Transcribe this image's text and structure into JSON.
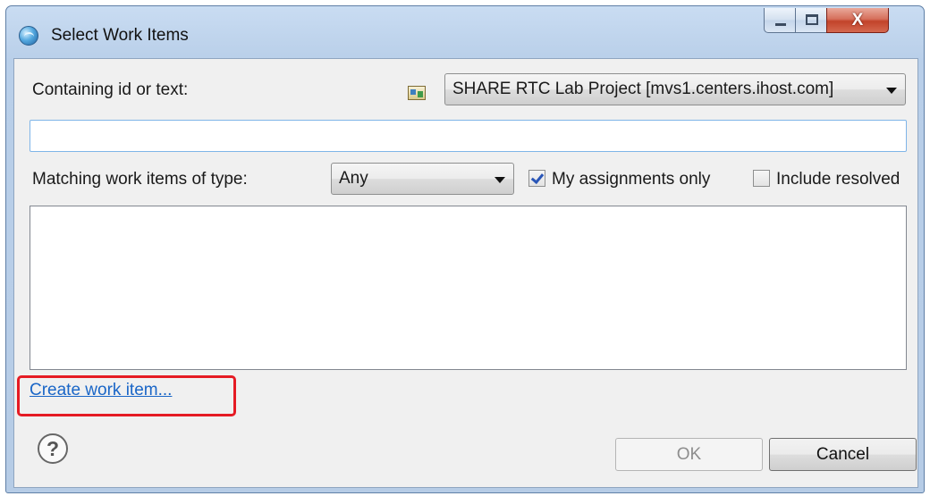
{
  "window": {
    "title": "Select Work Items"
  },
  "titlebar_buttons": {
    "close_glyph": "X"
  },
  "search": {
    "label": "Containing id or text:",
    "value": "",
    "placeholder": ""
  },
  "project": {
    "icon": "project-area-icon",
    "selected": "SHARE RTC Lab Project [mvs1.centers.ihost.com]"
  },
  "filter": {
    "type_label": "Matching work items of type:",
    "type_selected": "Any",
    "my_assignments_label": "My assignments only",
    "my_assignments_checked": true,
    "include_resolved_label": "Include resolved",
    "include_resolved_checked": false
  },
  "results": {
    "items": []
  },
  "create_link": "Create work item...",
  "help": {
    "glyph": "?"
  },
  "buttons": {
    "ok": "OK",
    "ok_enabled": false,
    "cancel": "Cancel"
  },
  "colors": {
    "link": "#1a66c7",
    "highlight_box": "#e51b24",
    "close_button": "#c2432a"
  }
}
